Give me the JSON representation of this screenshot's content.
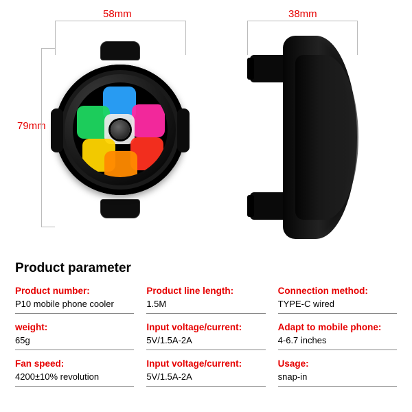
{
  "dimensions": {
    "width_mm": "58mm",
    "height_mm": "79mm",
    "depth_mm": "38mm"
  },
  "specs": {
    "heading": "Product parameter",
    "rows": [
      {
        "label": "Product number:",
        "value": "P10 mobile phone cooler"
      },
      {
        "label": "Product line length:",
        "value": "1.5M"
      },
      {
        "label": "Connection method:",
        "value": "TYPE-C wired"
      },
      {
        "label": "weight:",
        "value": "65g"
      },
      {
        "label": "Input voltage/current:",
        "value": "5V/1.5A-2A"
      },
      {
        "label": "Adapt to mobile phone:",
        "value": "4-6.7 inches"
      },
      {
        "label": "Fan speed:",
        "value": "4200±10% revolution"
      },
      {
        "label": "Input voltage/current:",
        "value": "5V/1.5A-2A"
      },
      {
        "label": "Usage:",
        "value": "snap-in"
      }
    ]
  }
}
